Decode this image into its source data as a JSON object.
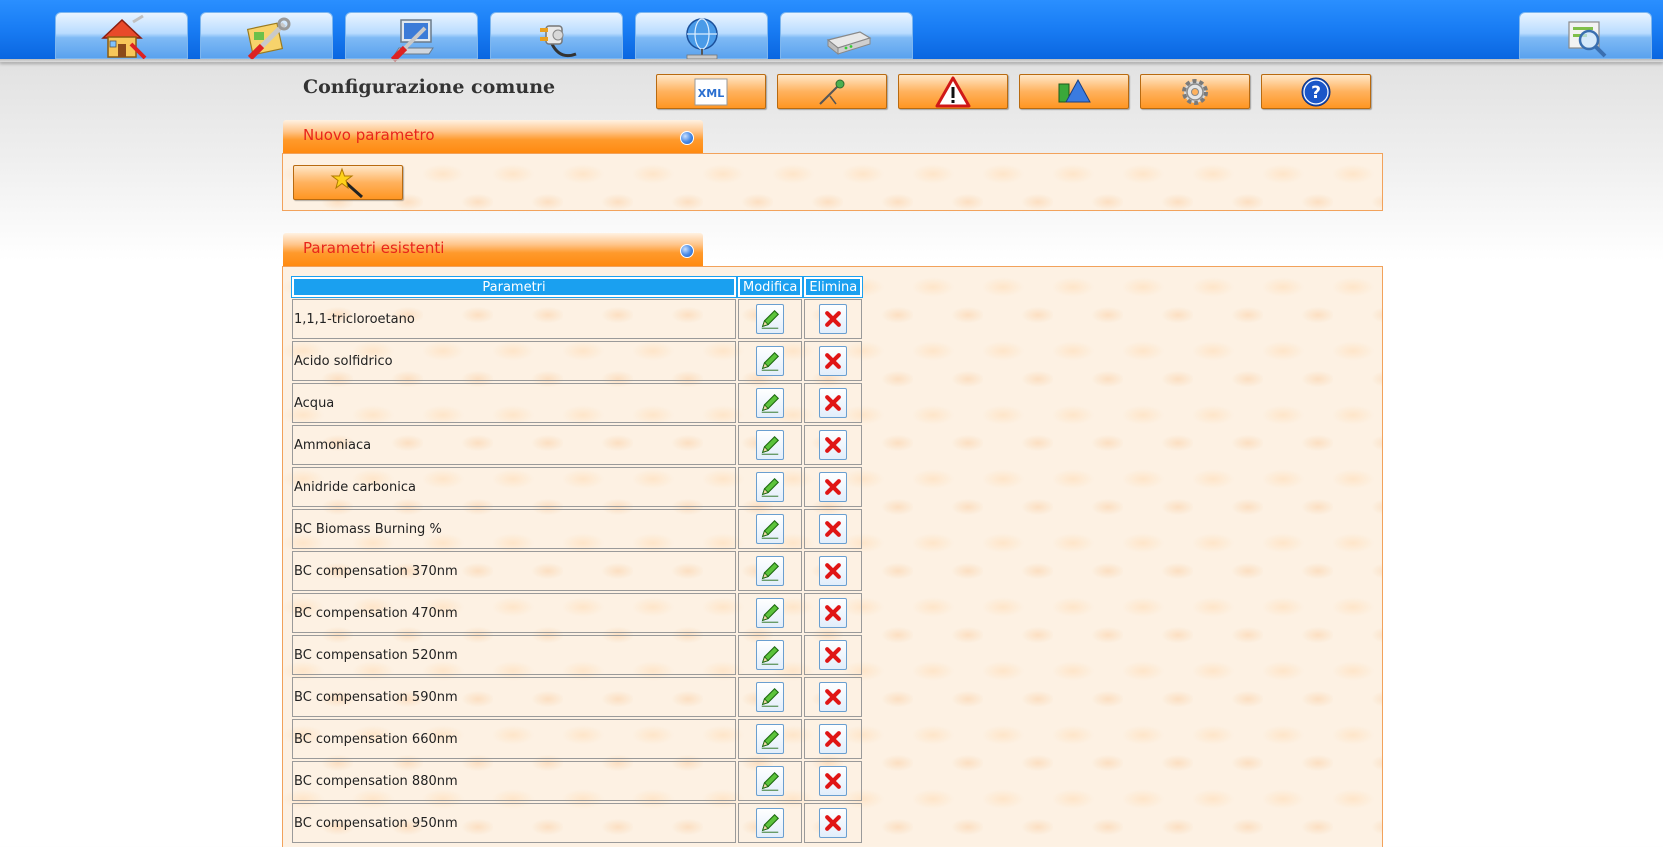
{
  "nav": {
    "tabs": [
      {
        "name": "home",
        "icon": "home-icon"
      },
      {
        "name": "tools",
        "icon": "tools-icon"
      },
      {
        "name": "computer",
        "icon": "computer-icon"
      },
      {
        "name": "connection",
        "icon": "plug-icon"
      },
      {
        "name": "network",
        "icon": "globe-network-icon"
      },
      {
        "name": "device",
        "icon": "device-icon"
      }
    ],
    "search_icon": "search-icon"
  },
  "page_title": "Configurazione comune",
  "toolbar": {
    "buttons": [
      {
        "name": "xml",
        "icon": "xml-icon",
        "label": "XML"
      },
      {
        "name": "probe",
        "icon": "probe-icon"
      },
      {
        "name": "alarm",
        "icon": "warning-icon"
      },
      {
        "name": "units",
        "icon": "shapes-icon"
      },
      {
        "name": "settings",
        "icon": "gear-icon"
      },
      {
        "name": "help",
        "icon": "help-icon",
        "label": "?"
      }
    ]
  },
  "new_param_panel": {
    "title": "Nuovo parametro",
    "button_icon": "magic-wand-icon"
  },
  "existing_panel": {
    "title": "Parametri esistenti",
    "columns": {
      "name": "Parametri",
      "edit": "Modifica",
      "delete": "Elimina"
    },
    "rows": [
      "1,1,1-tricloroetano",
      "Acido solfidrico",
      "Acqua",
      "Ammoniaca",
      "Anidride carbonica",
      "BC Biomass Burning %",
      "BC compensation 370nm",
      "BC compensation 470nm",
      "BC compensation 520nm",
      "BC compensation 590nm",
      "BC compensation 660nm",
      "BC compensation 880nm",
      "BC compensation 950nm"
    ]
  },
  "colors": {
    "topbar": "#1a7ef5",
    "panel_accent": "#ff9a2c",
    "panel_title": "#e8251b",
    "table_header": "#1aa0f0"
  }
}
